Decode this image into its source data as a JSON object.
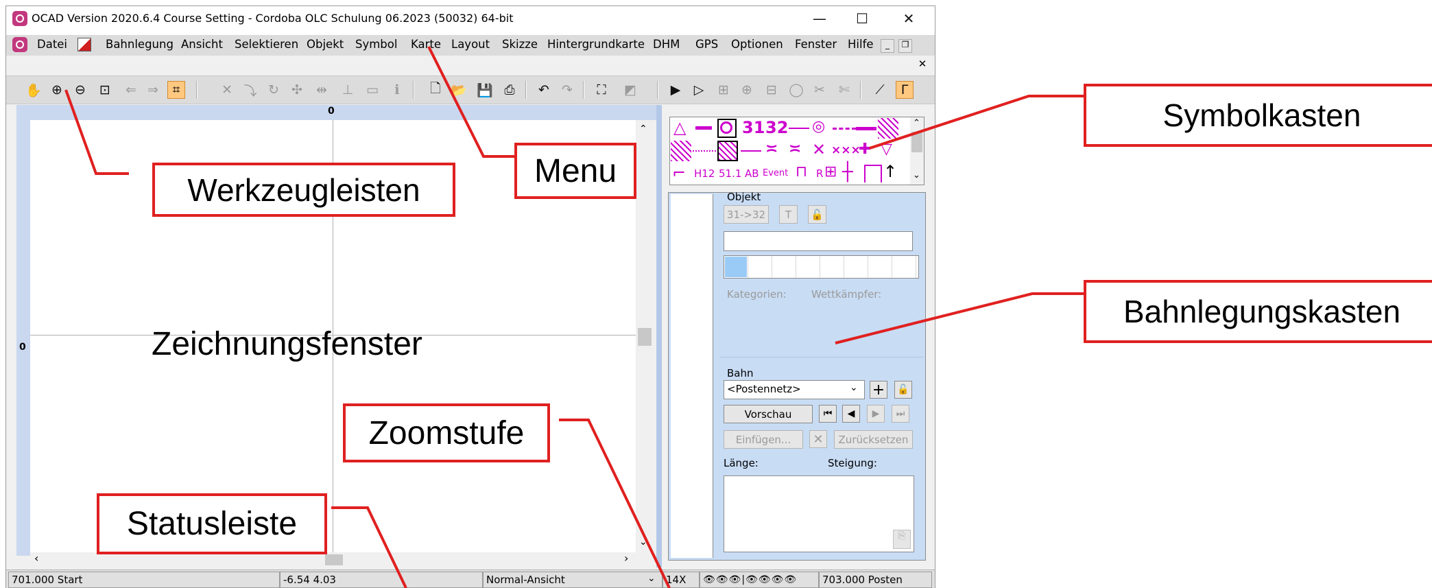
{
  "title": "OCAD Version 2020.6.4 Course Setting - Cordoba OLC Schulung 06.2023 (50032) 64-bit",
  "window_controls": {
    "minimize": "—",
    "maximize": "☐",
    "close": "✕"
  },
  "menu": [
    "Datei",
    "Bahnlegung",
    "Ansicht",
    "Selektieren",
    "Objekt",
    "Symbol",
    "Karte",
    "Layout",
    "Skizze",
    "Hintergrundkarte",
    "DHM",
    "GPS",
    "Optionen",
    "Fenster",
    "Hilfe"
  ],
  "ruler": {
    "top_zero": "0",
    "left_zero": "0"
  },
  "symbols": {
    "row1": [
      "31",
      "32"
    ],
    "row2": [
      "×××"
    ],
    "row3": [
      "H12",
      "51.1",
      "AB",
      "Event",
      "R"
    ]
  },
  "course_box": {
    "object_label": "Objekt",
    "btn_3132": "31->32",
    "btn_t": "T",
    "kategorien": "Kategorien:",
    "wettkaempfer": "Wettkämpfer:",
    "bahn_label": "Bahn",
    "bahn_select": "<Postennetz>",
    "vorschau": "Vorschau",
    "einfuegen": "Einfügen...",
    "zuruecksetzen": "Zurücksetzen",
    "laenge": "Länge:",
    "steigung": "Steigung:"
  },
  "statusbar": {
    "left": "701.000 Start",
    "coords": "-6.54   4.03",
    "view_mode": "Normal-Ansicht",
    "zoom": "14X",
    "right": "703.000 Posten"
  },
  "annotations": {
    "werkzeugleisten": "Werkzeugleisten",
    "menu": "Menu",
    "symbolkasten": "Symbolkasten",
    "bahnlegungskasten": "Bahnlegungskasten",
    "zeichnungsfenster": "Zeichnungsfenster",
    "zoomstufe": "Zoomstufe",
    "statusleiste": "Statusleiste"
  },
  "colors": {
    "accent": "#e02020",
    "symbol": "#cc00cc",
    "panel": "#c8dcf4",
    "active_tool": "#ffc880"
  }
}
